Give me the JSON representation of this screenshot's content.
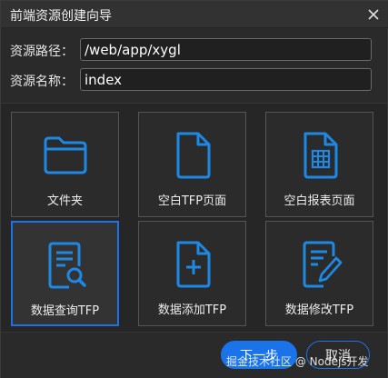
{
  "dialog": {
    "title": "前端资源创建向导",
    "close_icon": "close-icon"
  },
  "form": {
    "path_label": "资源路径：",
    "path_value": "/web/app/xygl",
    "name_label": "资源名称：",
    "name_value": "index"
  },
  "tiles": [
    {
      "label": "文件夹",
      "icon": "folder-icon",
      "selected": false
    },
    {
      "label": "空白TFP页面",
      "icon": "blank-page-icon",
      "selected": false
    },
    {
      "label": "空白报表页面",
      "icon": "report-page-icon",
      "selected": false
    },
    {
      "label": "数据查询TFP",
      "icon": "data-query-icon",
      "selected": true
    },
    {
      "label": "数据添加TFP",
      "icon": "data-add-icon",
      "selected": false
    },
    {
      "label": "数据修改TFP",
      "icon": "data-edit-icon",
      "selected": false
    }
  ],
  "footer": {
    "next_label": "下一步",
    "cancel_label": "取消"
  },
  "watermark": "掘金技术社区 @ Nodejs开发",
  "colors": {
    "accent": "#1a73e8",
    "icon": "#1e88e5",
    "background": "#2a2a2a"
  }
}
